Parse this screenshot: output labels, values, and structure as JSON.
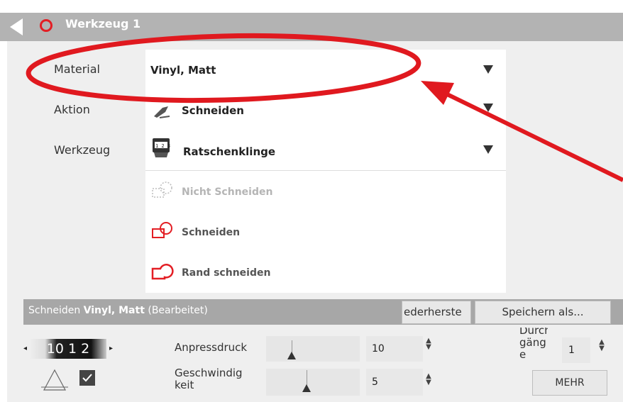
{
  "title": "Werkzeug 1",
  "rows": [
    {
      "label": "Material",
      "value": "Vinyl, Matt"
    },
    {
      "label": "Aktion",
      "value": "Schneiden"
    },
    {
      "label": "Werkzeug",
      "value": "Ratschenklinge"
    }
  ],
  "options": [
    "Nicht Schneiden",
    "Schneiden",
    "Rand schneiden"
  ],
  "bottom": {
    "title_prefix": "Schneiden ",
    "title_material": "Vinyl, Matt",
    "title_suffix": " (Bearbeitet)",
    "restore_label": "ederherste",
    "save_as_label": "Speichern als..."
  },
  "settings": {
    "blade_digits": "10 1 2",
    "pressure_label": "Anpressdruck",
    "pressure_value": "10",
    "speed_label_1": "Geschwindig",
    "speed_label_2": "keit",
    "speed_value": "5",
    "passes_label_1": "Durch",
    "passes_label_2": "gäng",
    "passes_label_3": "e",
    "passes_value": "1",
    "more_label": "MEHR"
  },
  "accent_color": "#e31e24",
  "annotation_color": "#e0191f"
}
